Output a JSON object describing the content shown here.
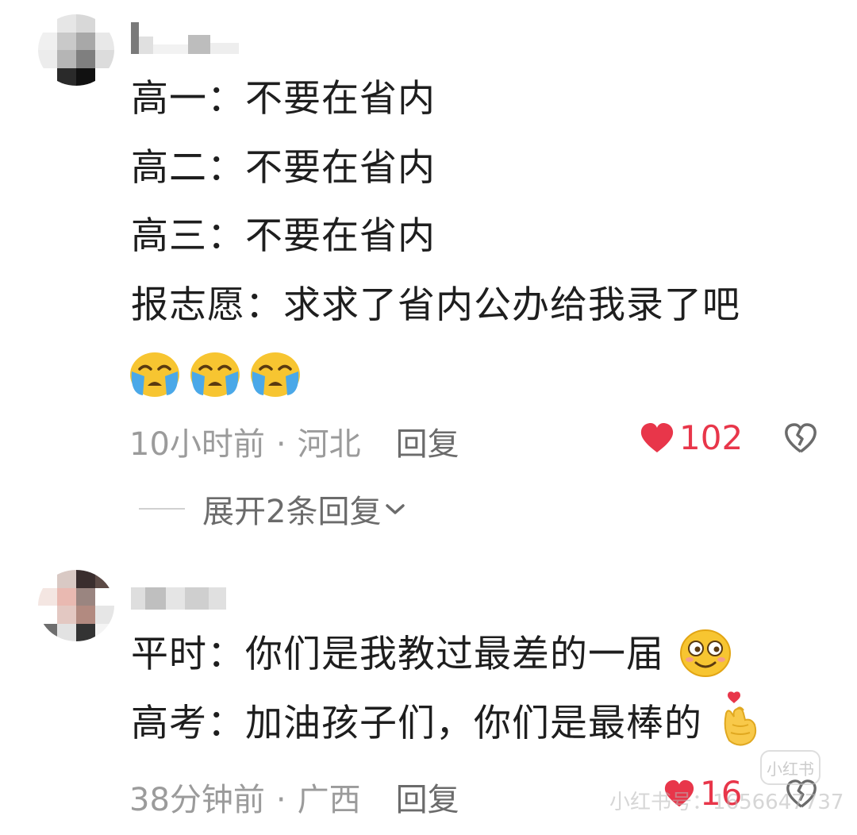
{
  "comments": [
    {
      "lines": [
        "高一：不要在省内",
        "高二：不要在省内",
        "高三：不要在省内",
        "报志愿：求求了省内公办给我录了吧"
      ],
      "emoji": [
        "crying-face-icon",
        "crying-face-icon",
        "crying-face-icon"
      ],
      "time": "10小时前",
      "location": "河北",
      "reply_label": "回复",
      "likes": "102",
      "expand_label": "展开2条回复",
      "expand_icon": "chevron-down-icon"
    },
    {
      "lines": [
        "平时：你们是我教过最差的一届",
        "高考：加油孩子们，你们是最棒的"
      ],
      "inline_emoji": [
        "smiley-face-icon",
        "finger-heart-icon"
      ],
      "time": "38分钟前",
      "location": "广西",
      "reply_label": "回复",
      "likes": "16"
    }
  ],
  "meta_separator": "·",
  "watermark": {
    "text": "小红书号：1656647737",
    "badge": "小红书"
  },
  "colors": {
    "like_heart": "#e8364a",
    "meta_text": "#9b9b9b",
    "reply_text": "#6b6b6b",
    "main_text": "#1e1e1e"
  }
}
